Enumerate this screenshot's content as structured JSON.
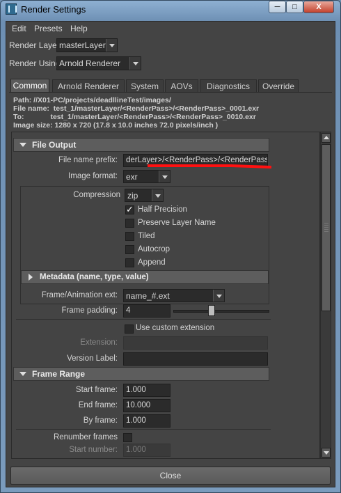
{
  "window": {
    "title": "Render Settings",
    "min": "─",
    "max": "□",
    "close": "X"
  },
  "menu": [
    "Edit",
    "Presets",
    "Help"
  ],
  "render_layer": {
    "label": "Render Layer",
    "value": "masterLayer"
  },
  "render_using": {
    "label": "Render Using",
    "value": "Arnold Renderer"
  },
  "tabs": [
    "Common",
    "Arnold Renderer",
    "System",
    "AOVs",
    "Diagnostics",
    "Override"
  ],
  "info": {
    "path": "Path: //X01-PC/projects/deadllineTest/images/",
    "file_name": "File name:  test_1/masterLayer/<RenderPass>/<RenderPass>_0001.exr",
    "to": "To:             test_1/masterLayer/<RenderPass>/<RenderPass>_0010.exr",
    "image_size": "Image size: 1280 x 720 (17.8 x 10.0 inches 72.0 pixels/inch )"
  },
  "file_output": {
    "header": "File Output",
    "prefix_label": "File name prefix:",
    "prefix_value": "derLayer>/<RenderPass>/<RenderPass>",
    "format_label": "Image format:",
    "format_value": "exr",
    "compression_label": "Compression",
    "compression_value": "zip",
    "half_precision": "Half Precision",
    "preserve_layer": "Preserve Layer Name",
    "tiled": "Tiled",
    "autocrop": "Autocrop",
    "append": "Append",
    "metadata_header": "Metadata (name, type, value)",
    "frame_ext_label": "Frame/Animation ext:",
    "frame_ext_value": "name_#.ext",
    "padding_label": "Frame padding:",
    "padding_value": "4",
    "padding_slider_fraction": 0.4,
    "custom_ext": "Use custom extension",
    "extension_label": "Extension:",
    "version_label": "Version Label:"
  },
  "frame_range": {
    "header": "Frame Range",
    "start_label": "Start frame:",
    "start_value": "1.000",
    "end_label": "End frame:",
    "end_value": "10.000",
    "by_label": "By frame:",
    "by_value": "1.000",
    "renumber_label": "Renumber frames",
    "start_number_label": "Start number:",
    "start_number_value": "1.000"
  },
  "close_button": "Close",
  "colors": {
    "panel": "#444444",
    "field": "#2b2b2b",
    "section": "#5d5d5d",
    "annotation": "#ff1010"
  }
}
